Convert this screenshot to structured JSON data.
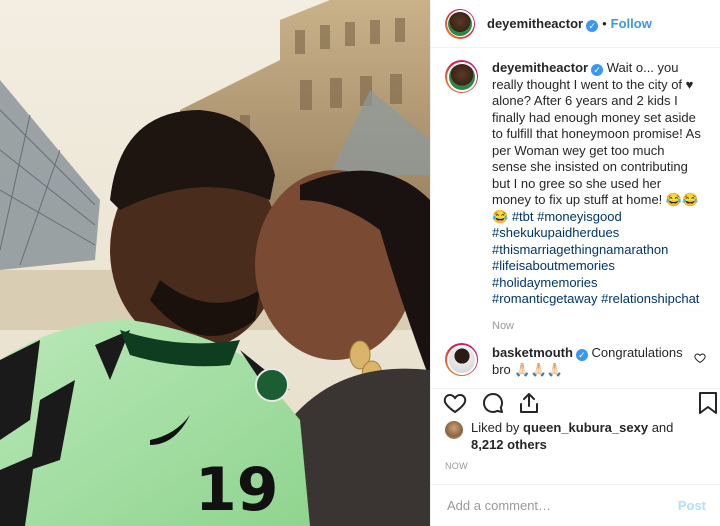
{
  "post": {
    "author": "deyemitheactor",
    "follow_label": "Follow",
    "separator": "•",
    "caption_parts": [
      {
        "text": "Wait o... you really thought I went to the city of ♥ alone? After 6 years and 2 kids I finally had enough money set aside to fulfill that honeymoon promise! As per Woman wey get too much sense she insisted on contributing but I no gree so she used her money to fix up stuff at home! 😂😂😂 ",
        "tag": false
      },
      {
        "text": "#tbt",
        "tag": true
      },
      {
        "text": " ",
        "tag": false
      },
      {
        "text": "#moneyisgood",
        "tag": true
      },
      {
        "text": " ",
        "tag": false
      },
      {
        "text": "#shekukupaidherdues",
        "tag": true
      },
      {
        "text": " ",
        "tag": false
      },
      {
        "text": "#thismarriagethingnamarathon",
        "tag": true
      },
      {
        "text": " ",
        "tag": false
      },
      {
        "text": "#lifeisaboutmemories",
        "tag": true
      },
      {
        "text": " ",
        "tag": false
      },
      {
        "text": "#holidaymemories",
        "tag": true
      },
      {
        "text": " ",
        "tag": false
      },
      {
        "text": "#romanticgetaway",
        "tag": true
      },
      {
        "text": " ",
        "tag": false
      },
      {
        "text": "#relationshipchat",
        "tag": true
      }
    ],
    "caption_time": "Now",
    "reply": {
      "author": "basketmouth",
      "text": "Congratulations bro 🙏🏻🙏🏻🙏🏻"
    },
    "likes": {
      "prefix": "Liked by",
      "user": "queen_kubura_sexy",
      "conj": "and",
      "others": "8,212 others"
    },
    "timestamp": "NOW",
    "add_comment_placeholder": "Add a comment…",
    "post_label": "Post"
  },
  "photo": {
    "jersey_number": "19"
  },
  "colors": {
    "link": "#3897f0",
    "hashtag": "#003569",
    "muted": "#999999",
    "post_disabled": "#b2dffc"
  },
  "icons": [
    "verified-badge-icon",
    "heart-icon",
    "comment-icon",
    "share-icon",
    "bookmark-icon",
    "like-heart-small-icon"
  ]
}
